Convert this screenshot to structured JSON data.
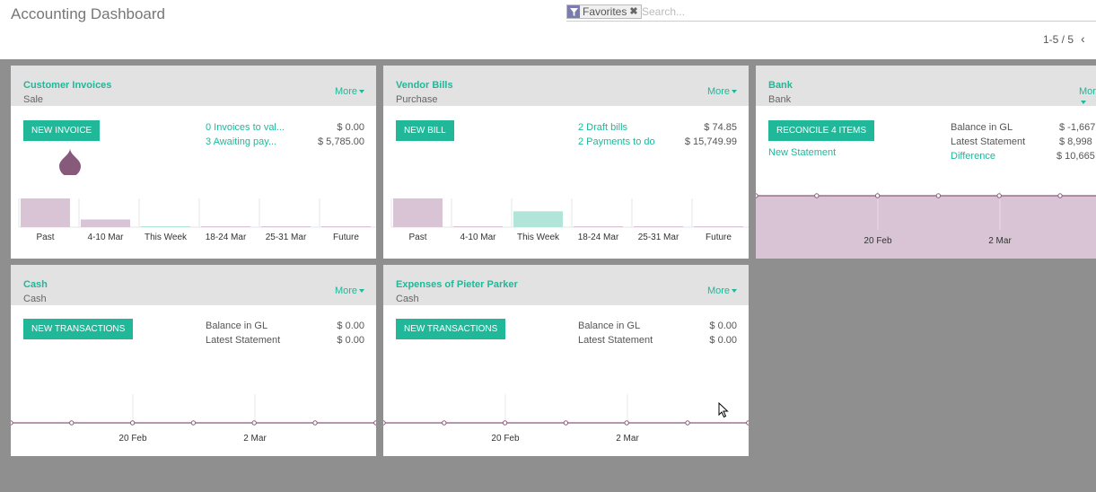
{
  "header": {
    "title": "Accounting Dashboard",
    "search": {
      "facet_label": "Favorites",
      "facet_remove": "✖",
      "placeholder": "Search..."
    },
    "pager": {
      "range": "1-5 / 5",
      "prev": "‹"
    }
  },
  "colors": {
    "accent": "#21b799",
    "graph_fill": "#d8c4d5",
    "graph_line": "#875a7b",
    "bar_current": "#b2e5d9",
    "background": "#8f8f8f"
  },
  "cards": {
    "customer_invoices": {
      "name": "Customer Invoices",
      "type": "Sale",
      "more": "More",
      "button": "New Invoice",
      "stats": [
        {
          "label": "0 Invoices to val...",
          "value": "$ 0.00"
        },
        {
          "label": "3 Awaiting pay...",
          "value": "$ 5,785.00"
        }
      ],
      "chart_data": {
        "type": "bar",
        "categories": [
          "Past",
          "4-10 Mar",
          "This Week",
          "18-24 Mar",
          "25-31 Mar",
          "Future"
        ],
        "values": [
          5785,
          1540,
          0,
          0,
          0,
          0
        ]
      }
    },
    "vendor_bills": {
      "name": "Vendor Bills",
      "type": "Purchase",
      "more": "More",
      "button": "New Bill",
      "stats": [
        {
          "label": "2 Draft bills",
          "value": "$ 74.85"
        },
        {
          "label": "2 Payments to do",
          "value": "$ 15,749.99"
        }
      ],
      "chart_data": {
        "type": "bar",
        "categories": [
          "Past",
          "4-10 Mar",
          "This Week",
          "18-24 Mar",
          "25-31 Mar",
          "Future"
        ],
        "values": [
          15750,
          0,
          8700,
          0,
          0,
          0
        ]
      }
    },
    "bank": {
      "name": "Bank",
      "type": "Bank",
      "more": "More",
      "button": "Reconcile 4 Items",
      "link": "New Statement",
      "stats": [
        {
          "label": "Balance in GL",
          "value": "$ -1,667"
        },
        {
          "label": "Latest Statement",
          "value": "$ 8,998"
        },
        {
          "label": "Difference",
          "value": "$ 10,665"
        }
      ],
      "chart_data": {
        "type": "area",
        "x_ticks": [
          "20 Feb",
          "2 Mar"
        ]
      }
    },
    "cash": {
      "name": "Cash",
      "type": "Cash",
      "more": "More",
      "button": "New Transactions",
      "stats": [
        {
          "label": "Balance in GL",
          "value": "$ 0.00"
        },
        {
          "label": "Latest Statement",
          "value": "$ 0.00"
        }
      ],
      "chart_data": {
        "type": "line",
        "x_ticks": [
          "20 Feb",
          "2 Mar"
        ]
      }
    },
    "expenses": {
      "name": "Expenses of Pieter Parker",
      "type": "Cash",
      "more": "More",
      "button": "New Transactions",
      "stats": [
        {
          "label": "Balance in GL",
          "value": "$ 0.00"
        },
        {
          "label": "Latest Statement",
          "value": "$ 0.00"
        }
      ],
      "chart_data": {
        "type": "line",
        "x_ticks": [
          "20 Feb",
          "2 Mar"
        ]
      }
    }
  }
}
